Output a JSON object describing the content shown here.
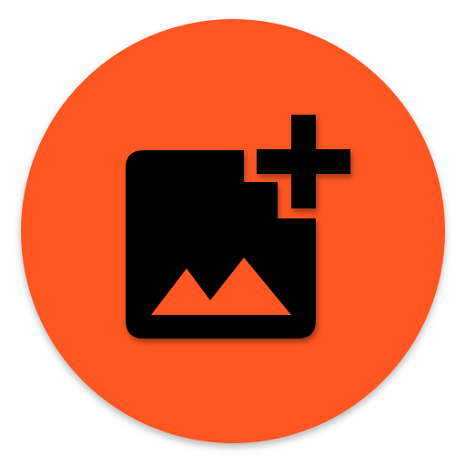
{
  "app_icon": {
    "icon": "add-photo-icon",
    "background_color": "#FF5722",
    "glyph_color": "#000000",
    "shadow_color": "#BF360C"
  }
}
